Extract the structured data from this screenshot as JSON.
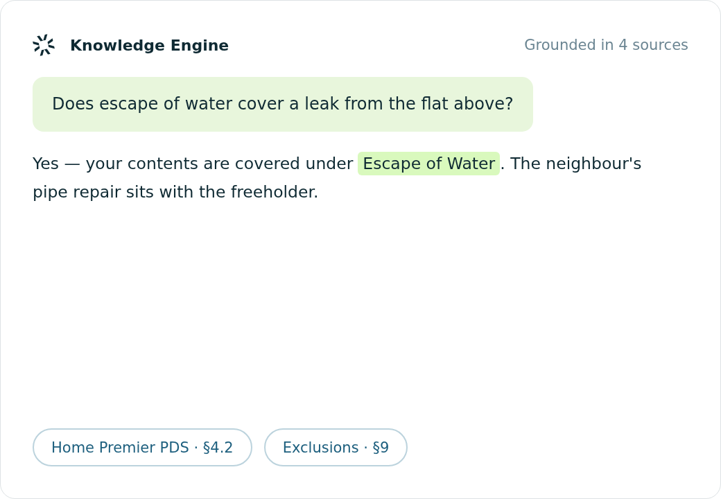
{
  "header": {
    "title": "Knowledge Engine",
    "sources_note": "Grounded in 4 sources"
  },
  "question": {
    "text": "Does escape of water cover a leak from the flat above?"
  },
  "answer": {
    "segments": [
      {
        "kind": "plain",
        "text": "Yes — your contents are covered under"
      },
      {
        "kind": "highlight",
        "text": "Escape of Water"
      },
      {
        "kind": "plain",
        "text": ". The neighbour's pipe repair sits with the freeholder."
      }
    ]
  },
  "citations": [
    {
      "label": "Home Premier PDS · §4.2"
    },
    {
      "label": "Exclusions · §9"
    }
  ]
}
